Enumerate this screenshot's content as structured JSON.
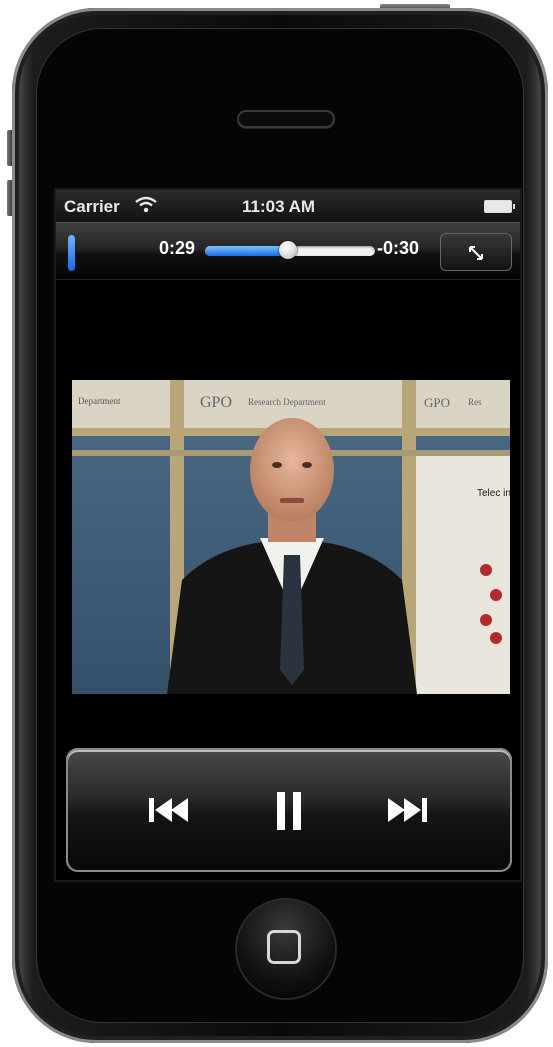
{
  "statusbar": {
    "carrier": "Carrier",
    "time": "11:03 AM",
    "wifi_icon": "wifi-icon",
    "battery_icon": "battery-icon"
  },
  "player": {
    "elapsed": "0:29",
    "remaining": "-0:30",
    "progress_fraction": 0.49,
    "fullscreen_icon": "fullscreen-toggle-icon"
  },
  "controls": {
    "previous_icon": "skip-back-icon",
    "pause_icon": "pause-icon",
    "next_icon": "skip-forward-icon"
  },
  "video": {
    "sign_left": "Department",
    "sign_logo": "GPO",
    "sign_center": "Research Department",
    "sign_right": "Res",
    "poster_text": "Telec in the"
  },
  "colors": {
    "progress_fill": "#1d6ce6",
    "control_text": "#ffffff"
  }
}
